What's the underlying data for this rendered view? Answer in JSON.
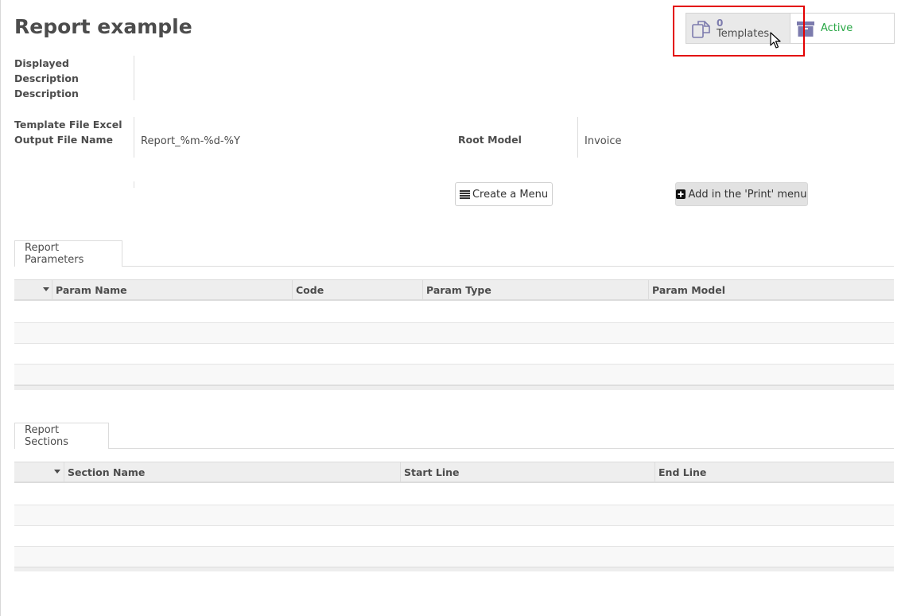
{
  "page": {
    "title": "Report example"
  },
  "smart_buttons": {
    "templates": {
      "count": "0",
      "label": "Templates"
    },
    "active": {
      "label": "Active"
    }
  },
  "fields": {
    "displayed_description_label": [
      "Displayed",
      "Description",
      "Description"
    ],
    "template_file_label": [
      "Template File Excel",
      "Output File Name"
    ],
    "template_file_value": "Report_%m-%d-%Y",
    "root_model_label": "Root Model",
    "root_model_value": "Invoice"
  },
  "actions": {
    "create_menu": "Create a Menu",
    "add_print": "Add in the 'Print' menu"
  },
  "parameters": {
    "tab_label": "Report Parameters",
    "columns": [
      "Param Name",
      "Code",
      "Param Type",
      "Param Model"
    ]
  },
  "sections": {
    "tab_label": "Report Sections",
    "columns": [
      "Section Name",
      "Start Line",
      "End Line"
    ]
  },
  "colors": {
    "accent": "#7c7bad",
    "active": "#28a745",
    "highlight": "#e30000"
  }
}
